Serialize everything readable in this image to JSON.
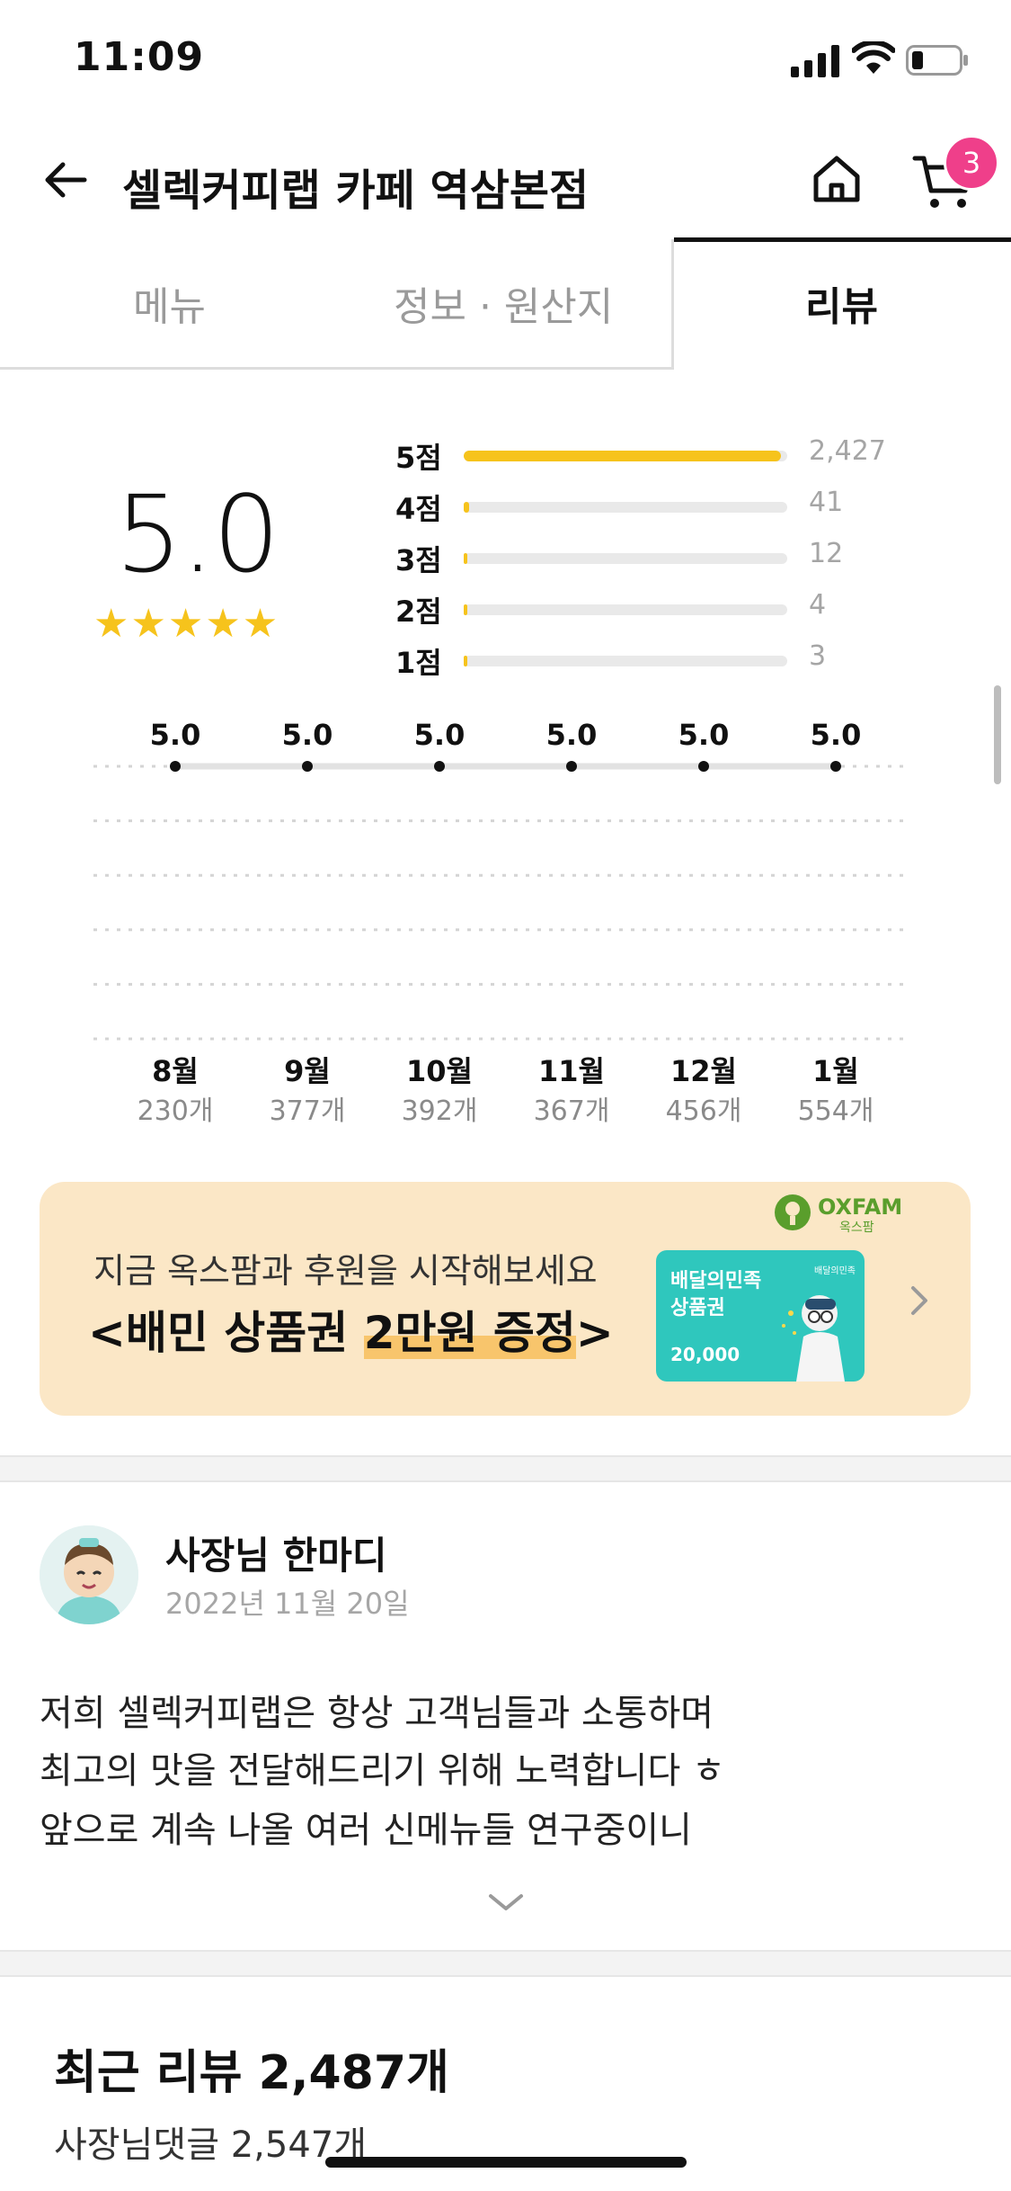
{
  "status_bar": {
    "time": "11:09"
  },
  "header": {
    "title": "셀렉커피랩 카페 역삼본점",
    "cart_count": "3"
  },
  "tabs": [
    {
      "label": "메뉴",
      "active": false
    },
    {
      "label": "정보 · 원산지",
      "active": false
    },
    {
      "label": "리뷰",
      "active": true
    }
  ],
  "rating": {
    "score": "5.0",
    "stars": "★★★★★",
    "rows": [
      {
        "label": "5점",
        "count": "2,427",
        "fraction": 0.98
      },
      {
        "label": "4점",
        "count": "41",
        "fraction": 0.017
      },
      {
        "label": "3점",
        "count": "12",
        "fraction": 0.005
      },
      {
        "label": "2점",
        "count": "4",
        "fraction": 0.002
      },
      {
        "label": "1점",
        "count": "3",
        "fraction": 0.001
      }
    ]
  },
  "chart_data": {
    "type": "line",
    "categories": [
      "8월",
      "9월",
      "10월",
      "11월",
      "12월",
      "1월"
    ],
    "values": [
      5.0,
      5.0,
      5.0,
      5.0,
      5.0,
      5.0
    ],
    "value_labels": [
      "5.0",
      "5.0",
      "5.0",
      "5.0",
      "5.0",
      "5.0"
    ],
    "counts": [
      "230개",
      "377개",
      "392개",
      "367개",
      "456개",
      "554개"
    ],
    "ylim": [
      0,
      5
    ],
    "grid": true,
    "colors": {
      "line": "#e2e2e2",
      "point": "#111111",
      "grid": "#d4d4d4"
    }
  },
  "banner": {
    "logo_text": "OXFAM",
    "logo_sub": "옥스팜",
    "subtitle": "지금 옥스팜과 후원을 시작해보세요",
    "main_prefix": "<배민 상품권 ",
    "main_highlight": "2만원 증정",
    "main_suffix": ">",
    "voucher_line1": "배달의민족",
    "voucher_line2": "상품권",
    "voucher_amount": "20,000",
    "voucher_brand": "배달의민족"
  },
  "owner": {
    "name": "사장님 한마디",
    "date": "2022년 11월 20일",
    "lines": [
      "저희 셀렉커피랩은 항상 고객님들과 소통하며",
      "최고의 맛을 전달해드리기 위해 노력합니다 ㅎ",
      "앞으로 계속 나올 여러 신메뉴들 연구중이니"
    ]
  },
  "reviews": {
    "title": "최근 리뷰 2,487개",
    "owner_replies": "사장님댓글 2,547개"
  }
}
